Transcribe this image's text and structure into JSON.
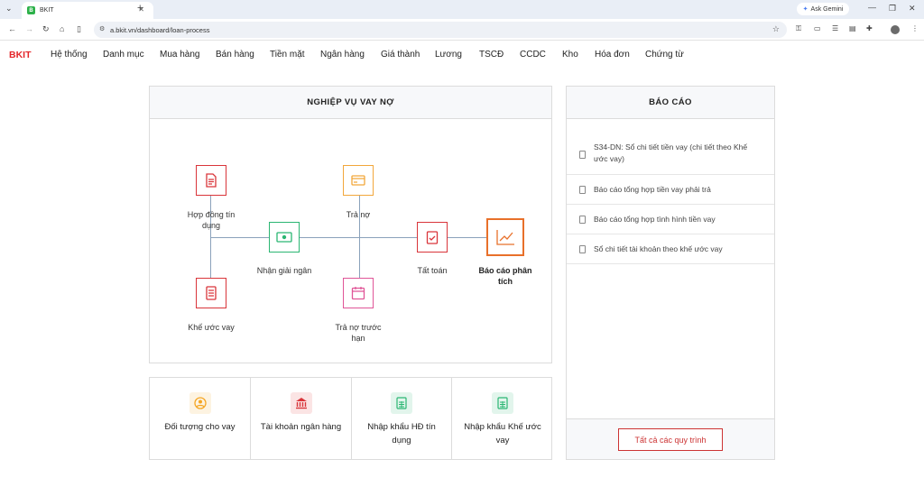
{
  "browser": {
    "tab_title": "BKIT",
    "favicon_letter": "B",
    "url": "a.bkit.vn/dashboard/loan-process",
    "gemini_label": "Ask Gemini"
  },
  "app": {
    "brand": "BKIT",
    "menu": [
      "Hệ thống",
      "Danh mục",
      "Mua hàng",
      "Bán hàng",
      "Tiền mặt",
      "Ngân hàng",
      "Giá thành",
      "Lương",
      "TSCĐ",
      "CCDC",
      "Kho",
      "Hóa đơn",
      "Chứng từ"
    ]
  },
  "process": {
    "title": "NGHIỆP VỤ VAY NỢ",
    "nodes": {
      "hop_dong": "Hợp đồng tín dụng",
      "tra_no": "Trả nợ",
      "nhan_giai_ngan": "Nhận giải ngân",
      "tat_toan": "Tất toán",
      "bao_cao": "Báo cáo phân tích",
      "khe_uoc": "Khế ước vay",
      "tra_no_truoc_han": "Trả nợ trước hạn"
    }
  },
  "reports": {
    "title": "BÁO CÁO",
    "items": [
      "S34-DN: Sổ chi tiết tiền vay (chi tiết theo Khế ước vay)",
      "Báo cáo tổng hợp tiền vay phải trả",
      "Báo cáo tổng hợp tình hình tiền vay",
      "Sổ chi tiết tài khoản theo khế ước vay"
    ],
    "all_button": "Tất cả các quy trình"
  },
  "shortcuts": [
    {
      "label": "Đối tượng cho vay",
      "icon": "user-circle-icon",
      "color": "#f5a623",
      "bg": "#fdf3e1"
    },
    {
      "label": "Tài khoản ngân hàng",
      "icon": "bank-icon",
      "color": "#d9353a",
      "bg": "#fbe4e4"
    },
    {
      "label": "Nhập khẩu HĐ tín dụng",
      "icon": "spreadsheet-icon",
      "color": "#2bb673",
      "bg": "#e2f5ec"
    },
    {
      "label": "Nhập khẩu Khế ước vay",
      "icon": "spreadsheet-icon",
      "color": "#2bb673",
      "bg": "#e2f5ec"
    }
  ],
  "colors": {
    "brand_red": "#e4262a",
    "node_red": "#d9353a",
    "node_orange": "#f2a73b",
    "node_green": "#2bb673",
    "node_pink": "#e05597",
    "node_report": "#e8702a"
  }
}
